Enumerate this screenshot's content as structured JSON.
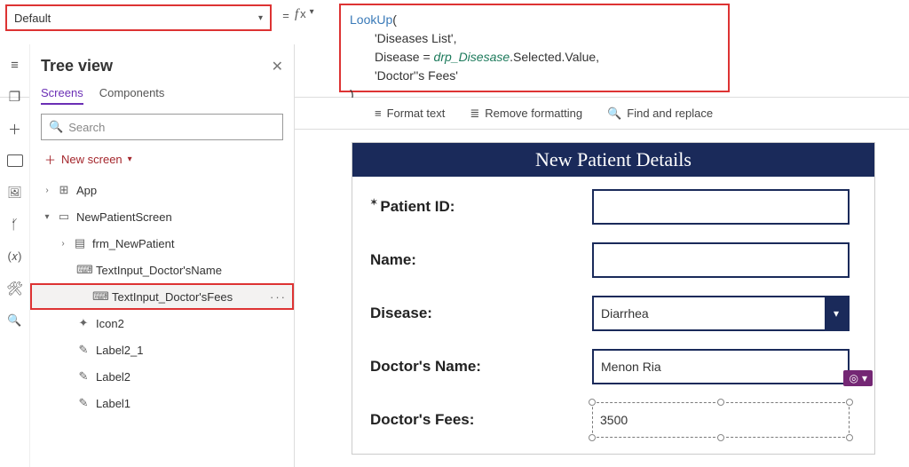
{
  "property_dropdown": {
    "selected": "Default"
  },
  "formula": {
    "l1a": "LookUp",
    "l1b": "(",
    "l2": "'Diseases List'",
    "l2b": ",",
    "l3a": "Disease = ",
    "l3b": "drp_Disesase",
    "l3c": ".Selected.Value,",
    "l4": "'Doctor''s Fees'",
    "l5": ")"
  },
  "toolbar": {
    "format": "Format text",
    "remove": "Remove formatting",
    "find": "Find and replace"
  },
  "tree": {
    "title": "Tree view",
    "tabs": {
      "screens": "Screens",
      "components": "Components"
    },
    "search_placeholder": "Search",
    "new_screen": "New screen",
    "items": {
      "app": "App",
      "screen": "NewPatientScreen",
      "form": "frm_NewPatient",
      "txt_docname": "TextInput_Doctor'sName",
      "txt_docfees": "TextInput_Doctor'sFees",
      "icon2": "Icon2",
      "label2_1": "Label2_1",
      "label2": "Label2",
      "label1": "Label1"
    }
  },
  "form": {
    "header": "New Patient Details",
    "labels": {
      "patient_id": "Patient ID:",
      "name": "Name:",
      "disease": "Disease:",
      "doctor_name": "Doctor's Name:",
      "doctor_fees": "Doctor's Fees:"
    },
    "values": {
      "patient_id": "",
      "name": "",
      "disease": "Diarrhea",
      "doctor_name": "Menon Ria",
      "doctor_fees": "3500"
    }
  },
  "glyphs": {
    "eq": "=",
    "fx": "fx",
    "chev_down": "▾",
    "chev_right": "›",
    "plus": "＋",
    "db": "🗄",
    "media": "🖼",
    "var": "(𝑥)",
    "tools": "⚙",
    "search": "🔍",
    "lines": "≡",
    "layers": "❐",
    "x": "✕",
    "more": "···",
    "tree_app": "⊞",
    "tree_screen": "▭",
    "tree_form": "▤",
    "tree_input": "⌨",
    "tree_icon": "✦",
    "tree_label": "✎"
  }
}
